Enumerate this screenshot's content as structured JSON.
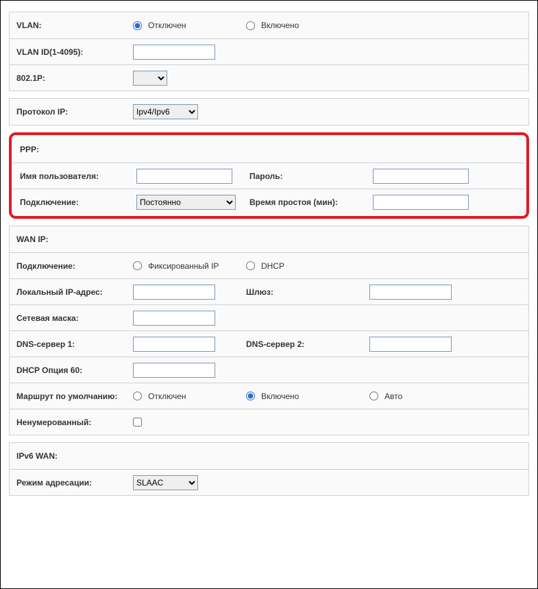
{
  "vlan": {
    "label": "VLAN:",
    "opt_off": "Отключен",
    "opt_on": "Включено",
    "id_label": "VLAN ID(1-4095):",
    "p_label": "802.1P:"
  },
  "proto": {
    "label": "Протокол IP:",
    "value": "Ipv4/Ipv6"
  },
  "ppp": {
    "label": "PPP:",
    "user_label": "Имя пользователя:",
    "pass_label": "Пароль:",
    "conn_label": "Подключение:",
    "conn_value": "Постоянно",
    "idle_label": "Время простоя (мин):"
  },
  "wan": {
    "label": "WAN IP:",
    "conn_label": "Подключение:",
    "fixed": "Фиксированный IP",
    "dhcp": "DHCP",
    "local_ip": "Локальный IP-адрес:",
    "gateway": "Шлюз:",
    "mask": "Сетевая маска:",
    "dns1": "DNS-сервер 1:",
    "dns2": "DNS-сервер 2:",
    "dhcp60": "DHCP Опция 60:",
    "route": "Маршрут по умолчанию:",
    "route_off": "Отключен",
    "route_on": "Включено",
    "route_auto": "Авто",
    "unnum": "Ненумерованный:"
  },
  "ipv6": {
    "label": "IPv6 WAN:",
    "addr_label": "Режим адресации:",
    "addr_value": "SLAAC"
  }
}
